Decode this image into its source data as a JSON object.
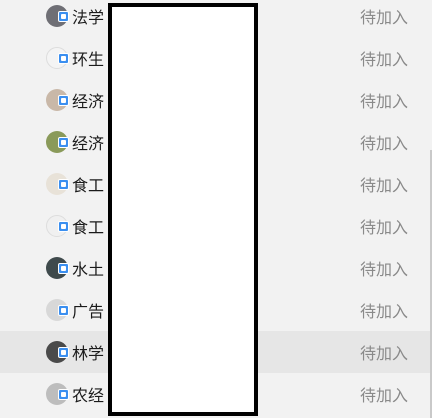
{
  "rows": [
    {
      "name": "法学",
      "status": "待加入",
      "avatar_icon": "avatar-dark-icon",
      "avatar_color": "#6f6f75"
    },
    {
      "name": "环生",
      "status": "待加入",
      "avatar_icon": "avatar-figure-icon",
      "avatar_color": "#f4f4f4"
    },
    {
      "name": "经济",
      "status": "待加入",
      "avatar_icon": "avatar-photo-icon",
      "avatar_color": "#c9b8a8"
    },
    {
      "name": "经济",
      "status": "待加入",
      "avatar_icon": "avatar-green-icon",
      "avatar_color": "#8a9a5a"
    },
    {
      "name": "食工",
      "status": "待加入",
      "avatar_icon": "avatar-child-icon",
      "avatar_color": "#e8e2d8"
    },
    {
      "name": "食工",
      "status": "待加入",
      "avatar_icon": "avatar-dog-icon",
      "avatar_color": "#f0f0f0"
    },
    {
      "name": "水土",
      "status": "待加入",
      "avatar_icon": "avatar-cap-icon",
      "avatar_color": "#3f4a4c"
    },
    {
      "name": "广告",
      "status": "待加入",
      "avatar_icon": "avatar-girl-icon",
      "avatar_color": "#d8d8d8"
    },
    {
      "name": "林学",
      "status": "待加入",
      "avatar_icon": "avatar-face-icon",
      "avatar_color": "#4a4a4a"
    },
    {
      "name": "农经",
      "status": "待加入",
      "avatar_icon": "avatar-cat-icon",
      "avatar_color": "#bdbdbd"
    }
  ],
  "badge_color": "#3b8ff0",
  "redaction_color": "#000000"
}
